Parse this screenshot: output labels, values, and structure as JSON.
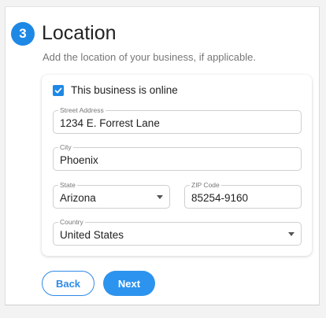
{
  "step": {
    "number": "3",
    "title": "Location",
    "subtitle": "Add the location of your business, if applicable."
  },
  "online_checkbox": {
    "label": "This business is online",
    "checked": true
  },
  "fields": {
    "street": {
      "label": "Street Address",
      "value": "1234 E. Forrest Lane"
    },
    "city": {
      "label": "City",
      "value": "Phoenix"
    },
    "state": {
      "label": "State",
      "value": "Arizona"
    },
    "zip": {
      "label": "ZIP Code",
      "value": "85254-9160"
    },
    "country": {
      "label": "Country",
      "value": "United States"
    }
  },
  "actions": {
    "back_label": "Back",
    "next_label": "Next"
  },
  "colors": {
    "accent": "#1e88e5",
    "next_button": "#2c93ee"
  },
  "icons": {
    "checkbox": "checkmark-icon",
    "select_caret": "caret-down-icon"
  }
}
